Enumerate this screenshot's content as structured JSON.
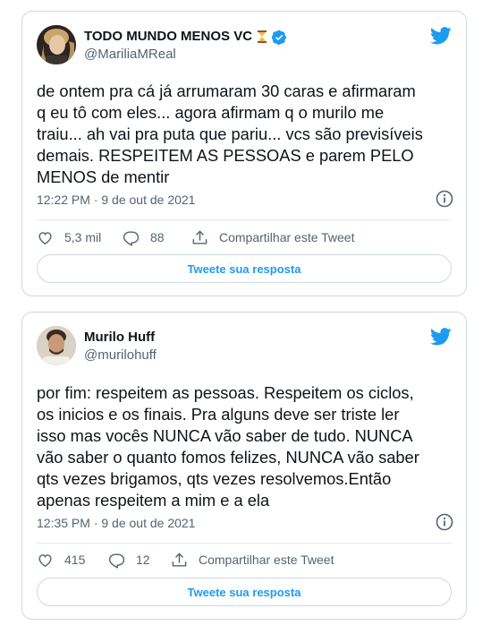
{
  "tweets": [
    {
      "display_name": "TODO MUNDO MENOS VC",
      "handle": "@MariliaMReal",
      "verified": true,
      "emoji": "hourglass-icon",
      "text": "de ontem pra cá já arrumaram 30 caras e afirmaram\nq eu tô com eles... agora afirmam q o murilo me\ntraiu... ah vai pra puta que pariu... vcs são previsíveis\ndemais. RESPEITEM AS PESSOAS e parem PELO\nMENOS de mentir",
      "timestamp": "12:22 PM · 9 de out de 2021",
      "likes": "5,3 mil",
      "replies": "88",
      "share_label": "Compartilhar este Tweet",
      "reply_button_label": "Tweete sua resposta"
    },
    {
      "display_name": "Murilo Huff",
      "handle": "@murilohuff",
      "verified": false,
      "text": "por fim: respeitem as pessoas. Respeitem os ciclos,\nos inicios e os finais. Pra alguns deve ser triste ler\nisso mas vocês NUNCA vão saber de tudo. NUNCA\nvão saber o quanto fomos felizes, NUNCA vão saber\nqts vezes brigamos, qts vezes resolvemos.Então\napenas respeitem a mim e a ela",
      "timestamp": "12:35 PM · 9 de out de 2021",
      "likes": "415",
      "replies": "12",
      "share_label": "Compartilhar este Tweet",
      "reply_button_label": "Tweete sua resposta"
    }
  ],
  "colors": {
    "twitter_blue": "#1d9bf0",
    "text_primary": "#0f1419",
    "text_secondary": "#536471",
    "border": "#cfd9de"
  }
}
